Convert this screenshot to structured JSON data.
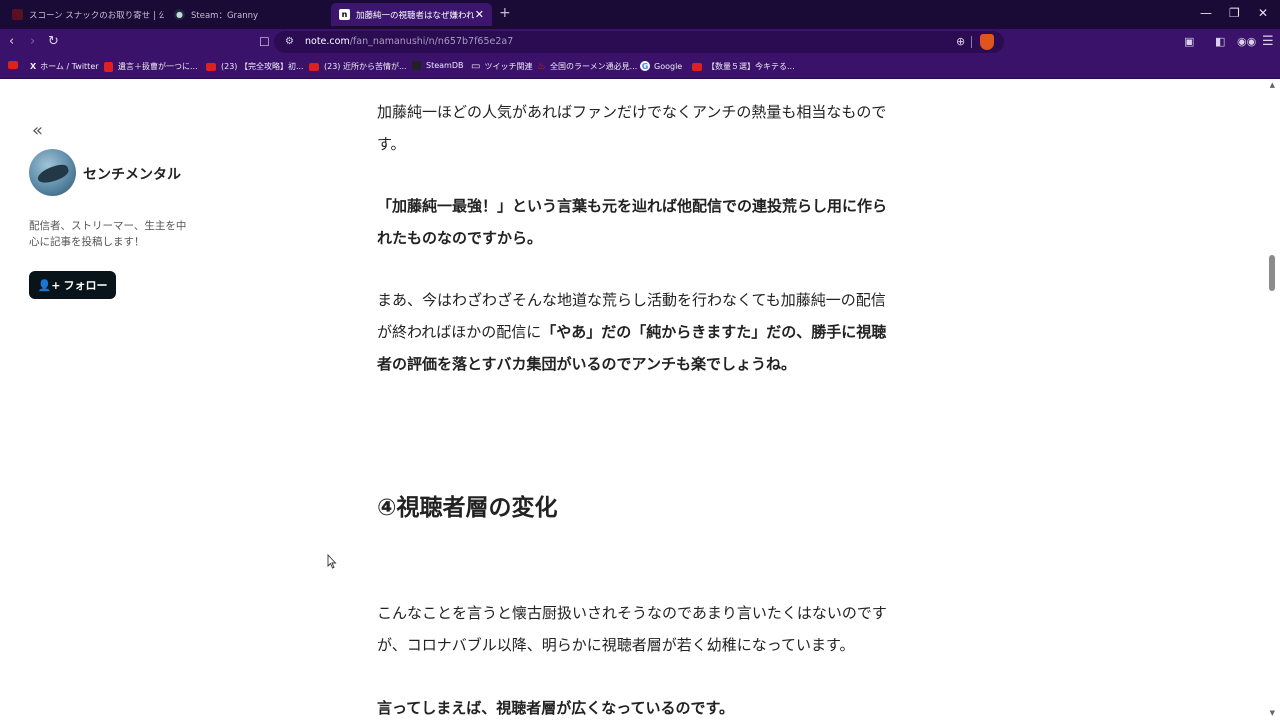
{
  "browser": {
    "tabs": [
      {
        "label": "スコーン スナックのお取り寄せ | 公式通販"
      },
      {
        "label": "Steam：Granny"
      },
      {
        "label": "加藤純一の視聴者はなぜ嫌われているのか"
      }
    ],
    "url_host": "note.com",
    "url_path": "/fan_namanushi/n/n657b7f65e2a7",
    "bookmarks": [
      {
        "label": "ホーム / Twitter"
      },
      {
        "label": "遺言＋扱曹が一つに..."
      },
      {
        "label": "(23) 【完全攻略】初..."
      },
      {
        "label": "(23) 近所から苦情が..."
      },
      {
        "label": "SteamDB"
      },
      {
        "label": "ツイッチ関連"
      },
      {
        "label": "全国のラーメン通必見..."
      },
      {
        "label": "Google"
      },
      {
        "label": "【数量５選】今キテる..."
      }
    ]
  },
  "sidebar": {
    "author_name": "センチメンタル",
    "bio": "配信者、ストリーマー、生主を中心に記事を投稿します！",
    "follow_label": "フォロー"
  },
  "article": {
    "p1": "加藤純一ほどの人気があればファンだけでなくアンチの熱量も相当なものです。",
    "p2": "「加藤純一最強！」という言葉も元を辿れば他配信での連投荒らし用に作られたものなのですから。",
    "p3_normal": "まあ、今はわざわざそんな地道な荒らし活動を行わなくても加藤純一の配信が終わればほかの配信に",
    "p3_bold": "「やあ」だの「純からきますた」だの、勝手に視聴者の評価を落とすバカ集団がいるのでアンチも楽でしょうね。",
    "heading": "④視聴者層の変化",
    "p4": "こんなことを言うと懐古厨扱いされそうなのであまり言いたくはないのですが、コロナバブル以降、明らかに視聴者層が若く幼稚になっています。",
    "p5": "言ってしまえば、視聴者層が広くなっているのです。"
  }
}
